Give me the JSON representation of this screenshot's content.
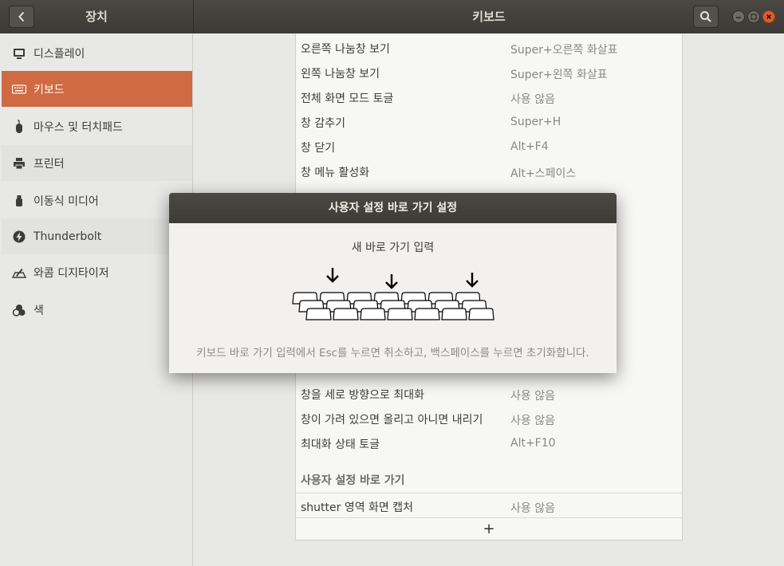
{
  "window": {
    "left_title": "장치",
    "main_title": "키보드",
    "icons": {
      "back": "chevron-left-icon",
      "search": "search-icon",
      "minimize": "minimize-icon",
      "maximize": "maximize-icon",
      "close": "close-icon"
    }
  },
  "sidebar": {
    "items": [
      {
        "label": "디스플레이",
        "icon": "display-icon"
      },
      {
        "label": "키보드",
        "icon": "keyboard-icon",
        "selected": true
      },
      {
        "label": "마우스 및 터치패드",
        "icon": "mouse-icon"
      },
      {
        "label": "프린터",
        "icon": "printer-icon"
      },
      {
        "label": "이동식 미디어",
        "icon": "usb-icon"
      },
      {
        "label": "Thunderbolt",
        "icon": "thunderbolt-icon"
      },
      {
        "label": "와콤 디지타이저",
        "icon": "tablet-icon"
      },
      {
        "label": "색",
        "icon": "color-icon"
      }
    ],
    "accent_color": "#cf6a43"
  },
  "shortcuts": {
    "top_rows": [
      {
        "name": "오른쪽 나눔창 보기",
        "value": "Super+오른쪽 화살표"
      },
      {
        "name": "왼쪽 나눔창 보기",
        "value": "Super+왼쪽 화살표"
      },
      {
        "name": "전체 화면 모드 토글",
        "value": "사용 않음"
      },
      {
        "name": "창 감추기",
        "value": "Super+H"
      },
      {
        "name": "창 닫기",
        "value": "Alt+F4"
      },
      {
        "name": "창 메뉴 활성화",
        "value": "Alt+스페이스"
      }
    ],
    "bottom_rows": [
      {
        "name": "창을 세로 방향으로 최대화",
        "value": "사용 않음"
      },
      {
        "name": "창이 가려 있으면 올리고 아니면 내리기",
        "value": "사용 않음"
      },
      {
        "name": "최대화 상태 토글",
        "value": "Alt+F10"
      }
    ],
    "custom_header": "사용자 설정 바로 가기",
    "custom_rows": [
      {
        "name": "shutter 영역 화면 캡처",
        "value": "사용 않음"
      }
    ],
    "add_label": "+"
  },
  "dialog": {
    "title": "사용자 설정 바로 가기 설정",
    "prompt": "새 바로 가기 입력",
    "hint": "키보드 바로 가기 입력에서 Esc를 누르면 취소하고, 백스페이스를 누르면 초기화합니다.",
    "illustration_icon": "keyboard-press-illustration-icon"
  }
}
